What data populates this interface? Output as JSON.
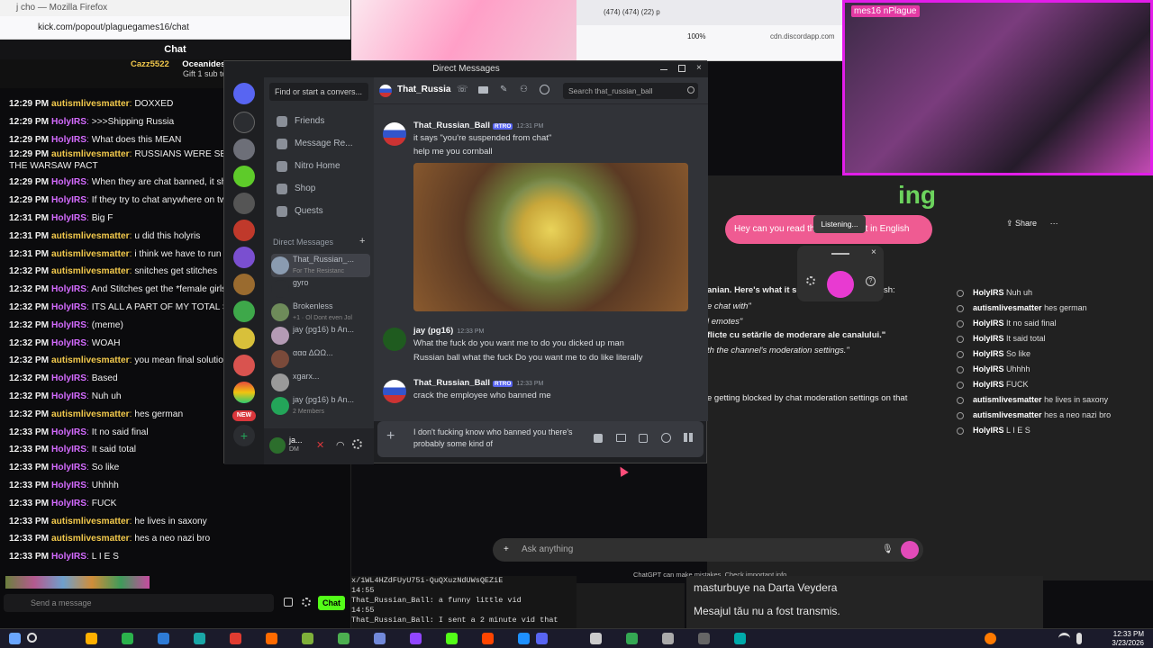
{
  "kick": {
    "window_title": "j cho — Mozilla Firefox",
    "url": "kick.com/popout/plaguegames16/chat",
    "chat_title": "Chat",
    "pinned_user": "Cazz5522",
    "pinned_user2": "Oceanides",
    "pinned_text": "Gift 1 sub to lal",
    "messages": [
      {
        "time": "12:29 PM",
        "user": "autismlivesmatter",
        "text": "DOXXED",
        "color": "#f2c94c"
      },
      {
        "time": "12:29 PM",
        "user": "HolyIRS",
        "text": ">>>Shipping Russia",
        "color": "#d46bff"
      },
      {
        "time": "12:29 PM",
        "user": "HolyIRS",
        "text": "What does this MEAN",
        "color": "#d46bff"
      },
      {
        "time": "12:29 PM",
        "user": "autismlivesmatter",
        "text": "RUSSIANS WERE SENT TO ... THEY WERE IN THE WARSAW PACT",
        "color": "#f2c94c"
      },
      {
        "time": "12:29 PM",
        "user": "HolyIRS",
        "text": "When they are chat banned, it shows",
        "color": "#d46bff"
      },
      {
        "time": "12:29 PM",
        "user": "HolyIRS",
        "text": "If they try to chat anywhere on twitch",
        "color": "#d46bff"
      },
      {
        "time": "12:31 PM",
        "user": "HolyIRS",
        "text": "Big F",
        "color": "#d46bff"
      },
      {
        "time": "12:31 PM",
        "user": "autismlivesmatter",
        "text": "u did this holyris",
        "color": "#f2c94c"
      },
      {
        "time": "12:31 PM",
        "user": "autismlivesmatter",
        "text": "i think we have to run him c",
        "color": "#f2c94c"
      },
      {
        "time": "12:32 PM",
        "user": "autismlivesmatter",
        "text": "snitches get stitches",
        "color": "#f2c94c"
      },
      {
        "time": "12:32 PM",
        "user": "HolyIRS",
        "text": "And Stitches get the *female girls wo",
        "color": "#d46bff"
      },
      {
        "time": "12:32 PM",
        "user": "HolyIRS",
        "text": "ITS ALL A PART OF MY TOTAL SOLUT",
        "color": "#d46bff"
      },
      {
        "time": "12:32 PM",
        "user": "HolyIRS",
        "text": "(meme)",
        "color": "#d46bff"
      },
      {
        "time": "12:32 PM",
        "user": "HolyIRS",
        "text": "WOAH",
        "color": "#d46bff"
      },
      {
        "time": "12:32 PM",
        "user": "autismlivesmatter",
        "text": "you mean final solution?",
        "color": "#f2c94c"
      },
      {
        "time": "12:32 PM",
        "user": "HolyIRS",
        "text": "Based",
        "color": "#d46bff"
      },
      {
        "time": "12:32 PM",
        "user": "HolyIRS",
        "text": "Nuh uh",
        "color": "#d46bff"
      },
      {
        "time": "12:32 PM",
        "user": "autismlivesmatter",
        "text": "hes german",
        "color": "#f2c94c"
      },
      {
        "time": "12:33 PM",
        "user": "HolyIRS",
        "text": "It no said final",
        "color": "#d46bff"
      },
      {
        "time": "12:33 PM",
        "user": "HolyIRS",
        "text": "It said total",
        "color": "#d46bff"
      },
      {
        "time": "12:33 PM",
        "user": "HolyIRS",
        "text": "So like",
        "color": "#d46bff"
      },
      {
        "time": "12:33 PM",
        "user": "HolyIRS",
        "text": "Uhhhh",
        "color": "#d46bff"
      },
      {
        "time": "12:33 PM",
        "user": "HolyIRS",
        "text": "FUCK",
        "color": "#d46bff"
      },
      {
        "time": "12:33 PM",
        "user": "autismlivesmatter",
        "text": "he lives in saxony",
        "color": "#f2c94c"
      },
      {
        "time": "12:33 PM",
        "user": "autismlivesmatter",
        "text": "hes a neo nazi bro",
        "color": "#f2c94c"
      },
      {
        "time": "12:33 PM",
        "user": "HolyIRS",
        "text": "L I E S",
        "color": "#d46bff"
      }
    ],
    "send_placeholder": "Send a message",
    "chat_button": "Chat"
  },
  "browser2": {
    "tabs": "(474)   (474)   (22) p",
    "zoom": "100%",
    "address": "cdn.discordapp.com"
  },
  "cam_label": "mes16 nPlague",
  "discord": {
    "title": "Direct Messages",
    "find_placeholder": "Find or start a convers...",
    "nav": [
      "Friends",
      "Message Re...",
      "Nitro Home",
      "Shop",
      "Quests"
    ],
    "dm_header": "Direct Messages",
    "dms": [
      {
        "name": "That_Russian_...",
        "sub": "For The Resistanc"
      },
      {
        "name": "gyro",
        "sub": ""
      },
      {
        "name": "Brokenless",
        "sub": "+1 · Ol Dont even Jol"
      },
      {
        "name": "jay (pg16) b An...",
        "sub": ""
      },
      {
        "name": "ααα ΔΩΩ...",
        "sub": ""
      },
      {
        "name": "xgarx...",
        "sub": ""
      },
      {
        "name": "jay (pg16) b An...",
        "sub": "2 Members"
      }
    ],
    "new_badge": "NEW",
    "user_short": "ja...",
    "user_sub": "DM",
    "channel": "That_Russia",
    "search_placeholder": "Search that_russian_ball",
    "msg1_user": "That_Russian_Ball",
    "msg1_tag": "RTRO",
    "msg1_time": "12:31 PM",
    "msg1_line1": "it says \"you're suspended from chat\"",
    "msg1_line2": "help me you cornball",
    "msg2_user": "jay (pg16)",
    "msg2_time": "12:33 PM",
    "msg2_line1": "What the fuck do you want me to do you dicked up man",
    "msg2_line2": "Russian ball what the fuck Do you want me to do like literally",
    "msg3_user": "That_Russian_Ball",
    "msg3_tag": "RTRO",
    "msg3_time": "12:33 PM",
    "msg3_line1": "crack the employee who banned me",
    "composer_text": "I don't fucking know who banned you there's probably some kind of"
  },
  "gpt": {
    "share": "Share",
    "bubble": "Hey can you read th",
    "bubble_tail": "ot in English",
    "listening": "Listening...",
    "lines": [
      {
        "text": "anian. Here's what it s",
        "style": "b"
      },
      {
        "text": "e chat with\"",
        "style": "i"
      },
      {
        "text": "l emotes\"",
        "style": "i"
      },
      {
        "text": "flicte cu setările de moderare ale canalului.\"",
        "style": "b"
      },
      {
        "text": "th the channel's moderation settings.\"",
        "style": "i"
      },
      {
        "text": "e getting blocked by chat moderation settings on that",
        "style": ""
      }
    ],
    "sh_suffix": "sh:",
    "ask_placeholder": "Ask anything",
    "note": "ChatGPT can make mistakes. Check important info.",
    "overlay_text": "ing"
  },
  "side_chat": [
    {
      "user": "HolyIRS",
      "text": "Nuh uh"
    },
    {
      "user": "autismlivesmatter",
      "text": "hes german"
    },
    {
      "user": "HolyIRS",
      "text": "It no said final"
    },
    {
      "user": "HolyIRS",
      "text": "It said total"
    },
    {
      "user": "HolyIRS",
      "text": "So like"
    },
    {
      "user": "HolyIRS",
      "text": "Uhhhh"
    },
    {
      "user": "HolyIRS",
      "text": "FUCK"
    },
    {
      "user": "autismlivesmatter",
      "text": "he lives in saxony"
    },
    {
      "user": "autismlivesmatter",
      "text": "hes a neo nazi bro"
    },
    {
      "user": "HolyIRS",
      "text": "L I E S"
    }
  ],
  "terminal": {
    "l1": "x/1WL4HZdFUyU75i-QuQXuzNdUWsQEZiE",
    "l2": "14:55",
    "l3": "That_Russian_Ball: a funny little vid",
    "l4": "14:55",
    "l5": "That_Russian_Ball: I sent a 2 minute vid that"
  },
  "ro_panel": {
    "a": "masturbuye na Darta Veydera",
    "b": "Mesajul tău nu a fost transmis."
  },
  "clock": {
    "time": "12:33 PM",
    "date": "3/23/2026"
  }
}
